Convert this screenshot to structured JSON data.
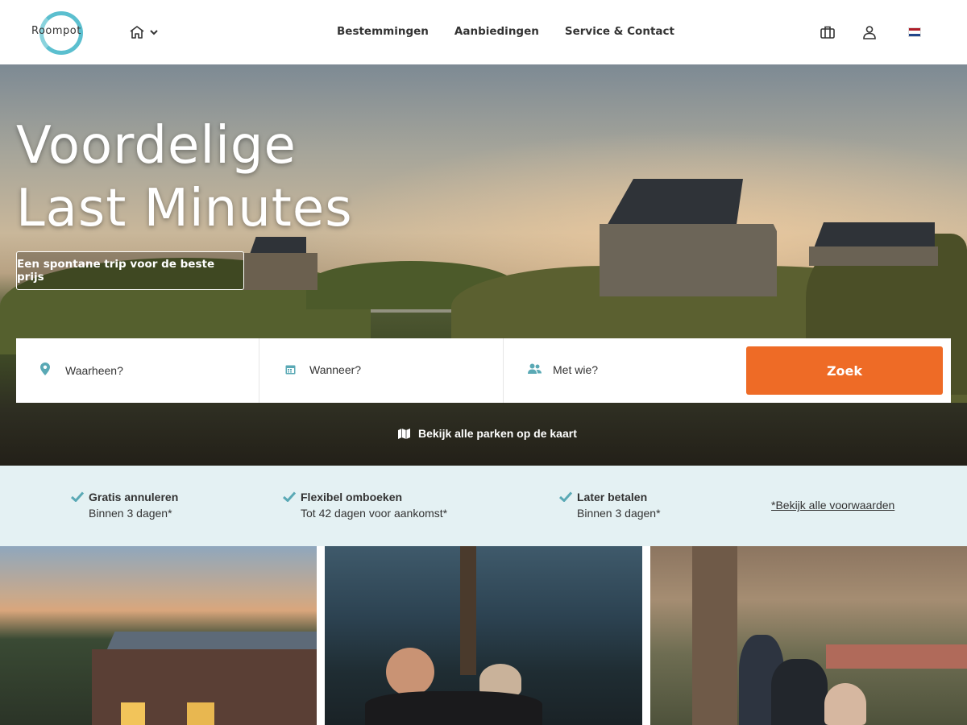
{
  "header": {
    "logo_text": "Roompot",
    "nav": [
      {
        "label": "Bestemmingen"
      },
      {
        "label": "Aanbiedingen"
      },
      {
        "label": "Service & Contact"
      }
    ]
  },
  "hero": {
    "title_line1": "Voordelige",
    "title_line2": "Last Minutes",
    "subtitle": "Een spontane trip voor de beste prijs"
  },
  "search": {
    "where": "Waarheen?",
    "when": "Wanneer?",
    "who": "Met wie?",
    "submit": "Zoek"
  },
  "map_link": "Bekijk alle parken op de kaart",
  "usps": [
    {
      "title": "Gratis annuleren",
      "detail": "Binnen 3 dagen*"
    },
    {
      "title": "Flexibel omboeken",
      "detail": "Tot 42 dagen voor aankomst*"
    },
    {
      "title": "Later betalen",
      "detail": "Binnen 3 dagen*"
    }
  ],
  "conditions_link": "*Bekijk alle voorwaarden",
  "colors": {
    "accent": "#ee6b26",
    "teal": "#5aa9b5",
    "usp_bg": "#e4f1f3"
  },
  "icons": [
    "home-icon",
    "chevron-down-icon",
    "suitcase-icon",
    "user-icon",
    "flag-nl-icon",
    "location-pin-icon",
    "calendar-icon",
    "people-icon",
    "map-icon",
    "check-icon"
  ]
}
